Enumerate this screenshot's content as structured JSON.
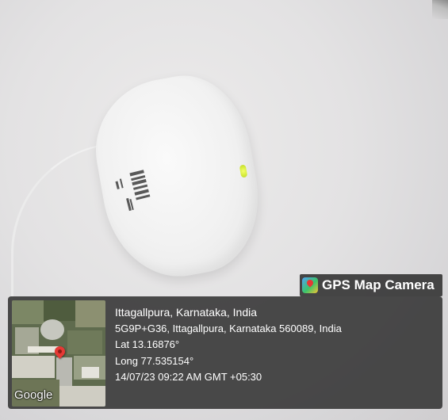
{
  "watermark": {
    "app_icon": "gps-map-camera-icon",
    "brand_label": "GPS Map Camera"
  },
  "location": {
    "place_title": "Ittagallpura, Karnataka, India",
    "address": "5G9P+G36, Ittagallpura, Karnataka 560089, India",
    "latitude": "Lat 13.16876°",
    "longitude": "Long 77.535154°",
    "timestamp": "14/07/23 09:22 AM GMT +05:30"
  },
  "map": {
    "provider_logo": "Google",
    "pin_icon": "map-pin-icon",
    "pin_color": "#e53935"
  },
  "colors": {
    "overlay_bg": "#373737",
    "text": "#ffffff",
    "led": "#d6ec3a"
  }
}
